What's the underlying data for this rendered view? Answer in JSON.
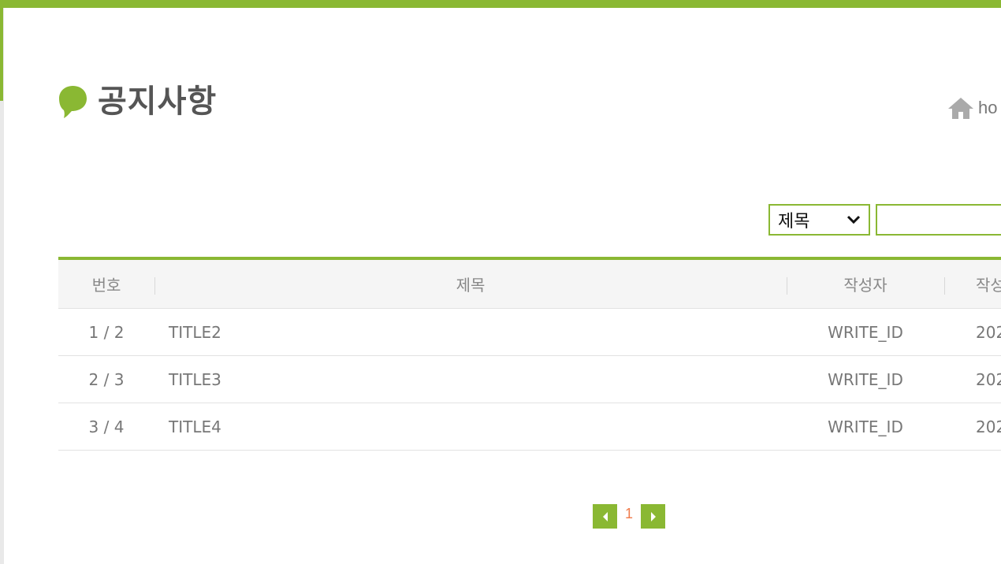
{
  "header": {
    "title": "공지사항",
    "home_label": "ho"
  },
  "search": {
    "field_selected": "제목",
    "keyword_value": "",
    "keyword_placeholder": ""
  },
  "board": {
    "columns": [
      "번호",
      "제목",
      "작성자",
      "작성일"
    ],
    "rows": [
      {
        "num": "1 / 2",
        "title": "TITLE2",
        "writer": "WRITE_ID",
        "date": "202"
      },
      {
        "num": "2 / 3",
        "title": "TITLE3",
        "writer": "WRITE_ID",
        "date": "202"
      },
      {
        "num": "3 / 4",
        "title": "TITLE4",
        "writer": "WRITE_ID",
        "date": "202"
      }
    ]
  },
  "pagination": {
    "current_page": "1",
    "prev_icon": "triangle-left-icon",
    "next_icon": "triangle-right-icon"
  },
  "colors": {
    "accent": "#8ab833",
    "page_active": "#f07a4a"
  }
}
